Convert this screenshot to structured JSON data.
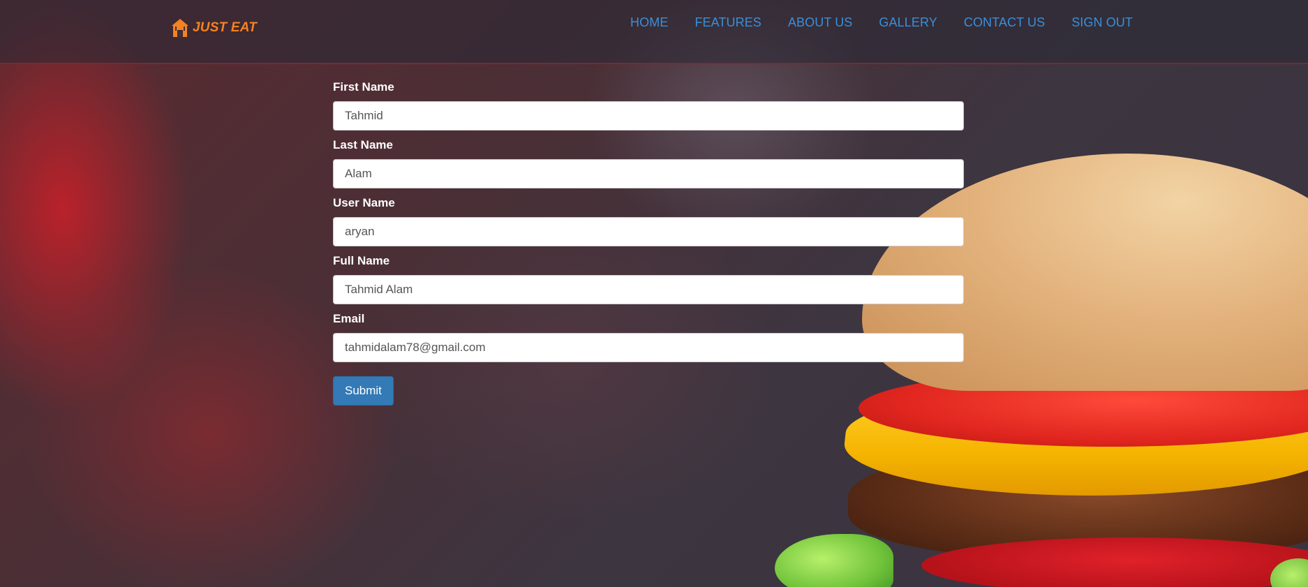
{
  "brand": {
    "name": "JUST EAT",
    "color": "#f58220",
    "icon": "house-fork-logo-icon"
  },
  "nav": {
    "items": [
      {
        "label": "HOME"
      },
      {
        "label": "FEATURES"
      },
      {
        "label": "ABOUT US"
      },
      {
        "label": "GALLERY"
      },
      {
        "label": "CONTACT US"
      },
      {
        "label": "SIGN OUT"
      }
    ],
    "link_color": "#3a8fd9"
  },
  "form": {
    "fields": [
      {
        "label": "First Name",
        "value": "Tahmid"
      },
      {
        "label": "Last Name",
        "value": "Alam"
      },
      {
        "label": "User Name",
        "value": "aryan"
      },
      {
        "label": "Full Name",
        "value": "Tahmid Alam"
      },
      {
        "label": "Email",
        "value": "tahmidalam78@gmail.com"
      }
    ],
    "submit_label": "Submit",
    "submit_color": "#337ab7"
  }
}
